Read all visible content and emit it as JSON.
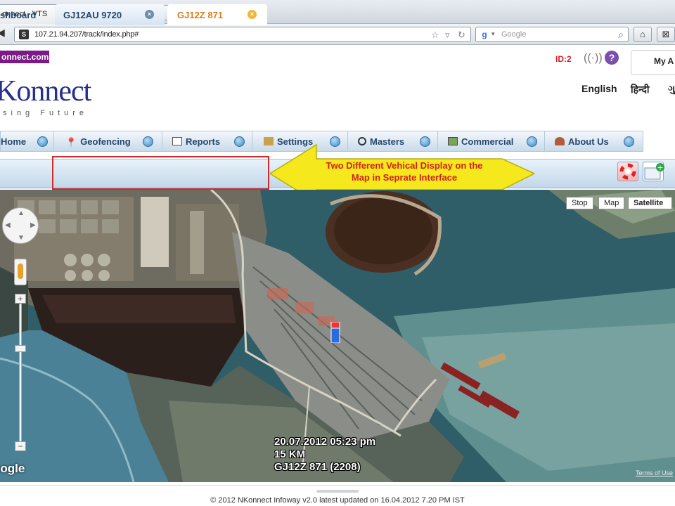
{
  "browser": {
    "tab_title": "onnect - VTS",
    "new_tab": "+",
    "url": "107.21.94.207/track/index.php#",
    "search_placeholder": "Google",
    "favicon": "S"
  },
  "header": {
    "domain_badge": "onnect.com",
    "logo_text": "Konnect",
    "tagline": "sing Future",
    "id_label": "ID:2",
    "help": "?",
    "my_account": "My A",
    "languages": [
      "English",
      "हिन्दी",
      "ગુ"
    ]
  },
  "menu": {
    "items": [
      {
        "label": "Home",
        "icon": "home-icon"
      },
      {
        "label": "Geofencing",
        "icon": "pin-icon"
      },
      {
        "label": "Reports",
        "icon": "report-icon"
      },
      {
        "label": "Settings",
        "icon": "settings-icon"
      },
      {
        "label": "Masters",
        "icon": "masters-icon"
      },
      {
        "label": "Commercial",
        "icon": "commercial-icon"
      },
      {
        "label": "About Us",
        "icon": "about-icon"
      }
    ]
  },
  "tabs": {
    "dashboard": "shboard",
    "vehicle_1": "GJ12AU 9720",
    "vehicle_2": "GJ12Z 871",
    "close": "×"
  },
  "annotation": {
    "line1": "Two Different Vehical Display on the",
    "line2": "Map in Seprate Interface"
  },
  "map": {
    "controls": {
      "stop": "Stop",
      "map": "Map",
      "satellite": "Satellite"
    },
    "zoom_in": "+",
    "zoom_out": "−",
    "google": "oogle",
    "terms": "Terms of Use",
    "vehicle_info": {
      "datetime": "20.07.2012 05:23 pm",
      "distance": "15 KM",
      "vehicle": "GJ12Z 871 (2208)"
    }
  },
  "footer": {
    "text": "© 2012 NKonnect Infoway v2.0 latest updated on 16.04.2012 7.20 PM IST"
  }
}
